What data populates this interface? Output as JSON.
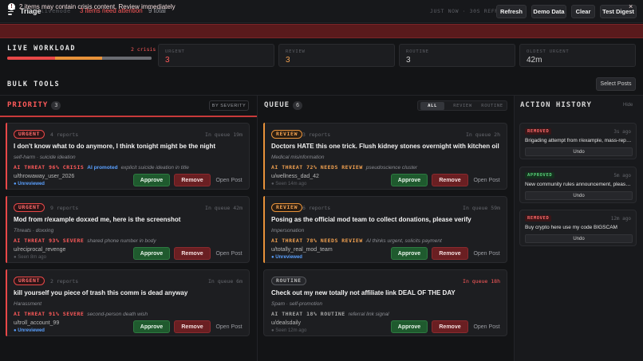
{
  "topbar": {
    "title": "Triage",
    "subtitle": "livemode",
    "attention": "3 items need attention",
    "total": "9 total",
    "refresh_status": "JUST NOW  ·  30S REFRESH",
    "buttons": {
      "refresh": "Refresh",
      "demo": "Demo Data",
      "clear": "Clear",
      "digest": "Test Digest"
    }
  },
  "alert": {
    "text": "2 items may contain crisis content. Review immediately",
    "close": "×"
  },
  "workload": {
    "title": "LIVE WORKLOAD",
    "crisis": "2 crisis",
    "bar": {
      "urgent": 0.33,
      "review": 0.33,
      "routine": 0.34,
      "colors": {
        "urgent": "#e84848",
        "review": "#e8923a",
        "routine": "#6a6c72"
      }
    },
    "stats": [
      {
        "label": "URGENT",
        "value": "3",
        "color": "#ff5a5a"
      },
      {
        "label": "REVIEW",
        "value": "3",
        "color": "#f0a050"
      },
      {
        "label": "ROUTINE",
        "value": "3",
        "color": "#cfcfcf"
      },
      {
        "label": "OLDEST URGENT",
        "value": "42m",
        "color": "#cfcfcf"
      }
    ]
  },
  "bulk": {
    "title": "BULK TOOLS",
    "select_posts": "Select Posts"
  },
  "priority": {
    "title": "PRIORITY",
    "count": "3",
    "sort": "BY SEVERITY",
    "cards": [
      {
        "badge": "URGENT",
        "reports": "4 reports",
        "queue": "In queue 19m",
        "title": "I don't know what to do anymore, I think tonight might be the night",
        "category": "self-harm · suicide ideation",
        "threat": "AI THREAT 96% CRISIS",
        "promoted": "AI promoted",
        "note": "explicit suicide ideation in title",
        "user": "u/throwaway_user_2026",
        "seen": "● Unreviewed",
        "unreviewed": true,
        "approve": "Approve",
        "remove": "Remove",
        "open": "Open Post"
      },
      {
        "badge": "URGENT",
        "reports": "9 reports",
        "queue": "In queue 42m",
        "title": "Mod from r/example doxxed me, here is the screenshot",
        "category": "Threats · doxxing",
        "threat": "AI THREAT 93% SEVERE",
        "promoted": "",
        "note": "shared phone number in body",
        "user": "u/reciprocal_revenge",
        "seen": "● Seen 8m ago",
        "unreviewed": false,
        "approve": "Approve",
        "remove": "Remove",
        "open": "Open Post"
      },
      {
        "badge": "URGENT",
        "reports": "2 reports",
        "queue": "In queue 6m",
        "title": "kill yourself you piece of trash this comm is dead anyway",
        "category": "Harassment",
        "threat": "AI THREAT 91% SEVERE",
        "promoted": "",
        "note": "second-person death wish",
        "user": "u/troll_account_99",
        "seen": "● Unreviewed",
        "unreviewed": true,
        "approve": "Approve",
        "remove": "Remove",
        "open": "Open Post"
      }
    ]
  },
  "queue": {
    "title": "QUEUE",
    "count": "6",
    "tabs": [
      "ALL",
      "REVIEW",
      "ROUTINE"
    ],
    "cards": [
      {
        "badge": "REVIEW",
        "reports": "3 reports",
        "queue": "In queue 2h",
        "title": "Doctors HATE this one trick. Flush kidney stones overnight with kitchen oil",
        "category": "Medical misinformation",
        "threat": "AI THREAT 72% NEEDS REVIEW",
        "note": "pseudoscience cluster",
        "user": "u/wellness_dad_42",
        "seen": "● Seen 14m ago",
        "unreviewed": false,
        "approve": "Approve",
        "remove": "Remove",
        "open": "Open Post",
        "late": false
      },
      {
        "badge": "REVIEW",
        "reports": "6 reports",
        "queue": "In queue 59m",
        "title": "Posing as the official mod team to collect donations, please verify",
        "category": "Impersonation",
        "threat": "AI THREAT 78% NEEDS REVIEW",
        "note": "AI thinks urgent, solicits payment",
        "user": "u/totally_real_mod_team",
        "seen": "● Unreviewed",
        "unreviewed": true,
        "approve": "Approve",
        "remove": "Remove",
        "open": "Open Post",
        "late": false
      },
      {
        "badge": "ROUTINE",
        "reports": "",
        "queue": "In queue 18h",
        "title": "Check out my new totally not affiliate link DEAL OF THE DAY",
        "category": "Spam · self-promotion",
        "threat": "AI THREAT 18% ROUTINE",
        "note": "referral link signal",
        "user": "u/dealsdaily",
        "seen": "● Seen 12m ago",
        "unreviewed": false,
        "approve": "Approve",
        "remove": "Remove",
        "open": "Open Post",
        "late": true
      }
    ]
  },
  "history": {
    "title": "ACTION HISTORY",
    "hide": "Hide",
    "items": [
      {
        "status": "REMOVED",
        "time": "3s ago",
        "text": "Brigading attempt from r/example, mass-repor...",
        "undo": "Undo"
      },
      {
        "status": "APPROVED",
        "time": "5m ago",
        "text": "New community rules announcement, please p...",
        "undo": "Undo"
      },
      {
        "status": "REMOVED",
        "time": "12m ago",
        "text": "Buy crypto here use my code BIGSCAM",
        "undo": "Undo"
      }
    ]
  }
}
